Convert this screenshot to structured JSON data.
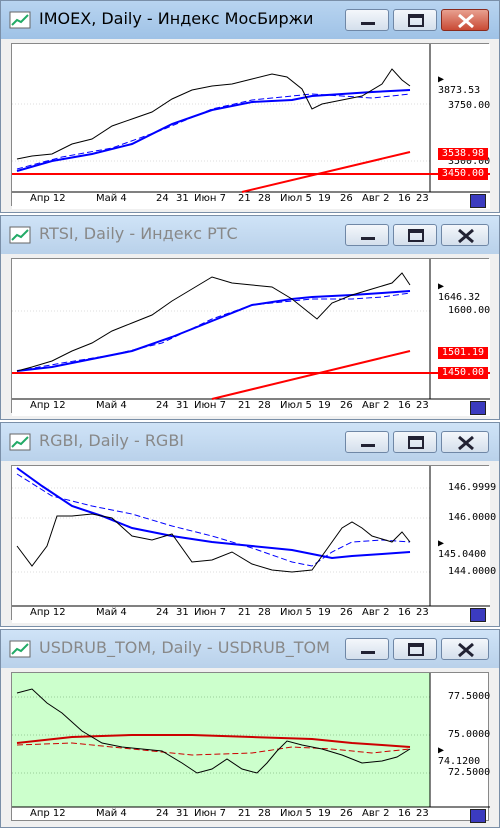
{
  "windows": [
    {
      "title": "IMOEX, Daily - Индекс МосБиржи",
      "current": "3873.53",
      "y_ticks": [
        "3750.00",
        "3500.00"
      ],
      "markers": [
        "3538.98",
        "3450.00"
      ],
      "x_ticks": [
        "Апр 12",
        "Май 4",
        "24",
        "31",
        "Июн 7",
        "21",
        "28",
        "Июл 5",
        "19",
        "26",
        "Авг 2",
        "16",
        "23"
      ]
    },
    {
      "title": "RTSI, Daily - Индекс РТС",
      "current": "1646.32",
      "y_ticks": [
        "1600.00"
      ],
      "markers": [
        "1501.19",
        "1450.00"
      ],
      "x_ticks": [
        "Апр 12",
        "Май 4",
        "24",
        "31",
        "Июн 7",
        "21",
        "28",
        "Июл 5",
        "19",
        "26",
        "Авг 2",
        "16",
        "23"
      ]
    },
    {
      "title": "RGBI, Daily - RGBI",
      "current": "145.0400",
      "y_ticks": [
        "146.9999",
        "146.0000",
        "144.0000"
      ],
      "markers": [],
      "x_ticks": [
        "Апр 12",
        "Май 4",
        "24",
        "31",
        "Июн 7",
        "21",
        "28",
        "Июл 5",
        "19",
        "26",
        "Авг 2",
        "16",
        "23"
      ]
    },
    {
      "title": "USDRUB_TOM, Daily - USDRUB_TOM",
      "current": "74.1200",
      "y_ticks": [
        "77.5000",
        "75.0000",
        "72.5000"
      ],
      "markers": [],
      "x_ticks": [
        "Апр 12",
        "Май 4",
        "24",
        "31",
        "Июн 7",
        "21",
        "28",
        "Июл 5",
        "19",
        "26",
        "Авг 2",
        "16",
        "23"
      ]
    }
  ],
  "colors": {
    "ma_blue": "#0000ff",
    "trend_red": "#ff0000",
    "current_bg": "#000000",
    "marker_bg": "#ff0000"
  }
}
